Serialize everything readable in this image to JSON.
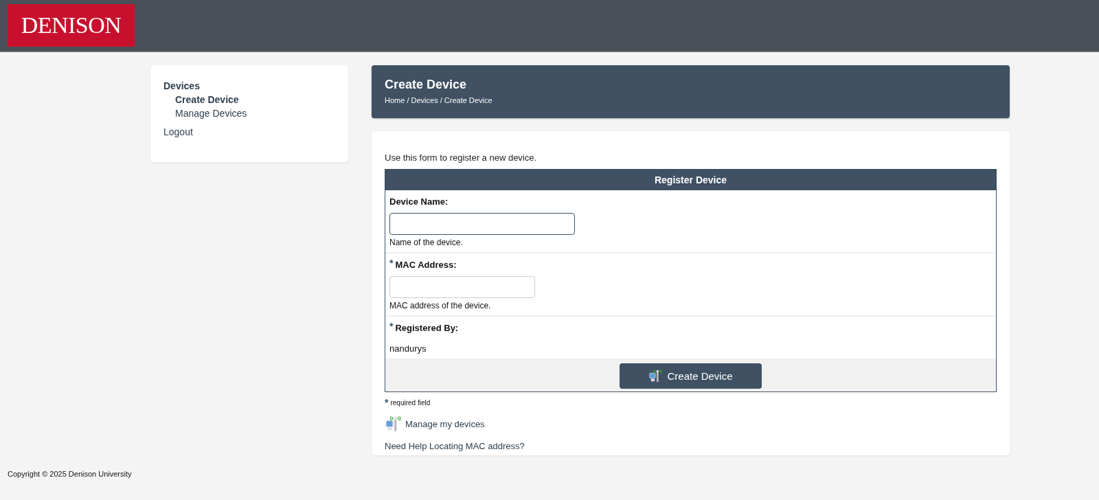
{
  "header": {
    "logo": "DENISON"
  },
  "sidebar": {
    "items": [
      {
        "label": "Devices",
        "children": [
          {
            "label": "Create Device",
            "selected": true
          },
          {
            "label": "Manage Devices",
            "selected": false
          }
        ]
      },
      {
        "label": "Logout",
        "selected": false
      }
    ]
  },
  "page_header": {
    "title": "Create Device",
    "breadcrumb": "Home / Devices / Create Device"
  },
  "intro": "Use this form to register a new device.",
  "form": {
    "title": "Register Device",
    "fields": [
      {
        "kind": "input",
        "label": "Device Name:",
        "required": false,
        "focused": true,
        "help": "Name of the device."
      },
      {
        "kind": "input",
        "label": "MAC Address:",
        "required": true,
        "focused": false,
        "help": "MAC address of the device."
      },
      {
        "kind": "text",
        "label": "Registered By:",
        "required": true,
        "value": "nandurys"
      }
    ],
    "submit": "Create Device"
  },
  "required_note": {
    "mark": "*",
    "text": "required field"
  },
  "links": [
    {
      "kind": "icon",
      "label": "Manage my devices"
    },
    {
      "kind": "plain",
      "label": "Need Help Locating MAC address?"
    }
  ],
  "footer": "Copyright © 2025 Denison University"
}
